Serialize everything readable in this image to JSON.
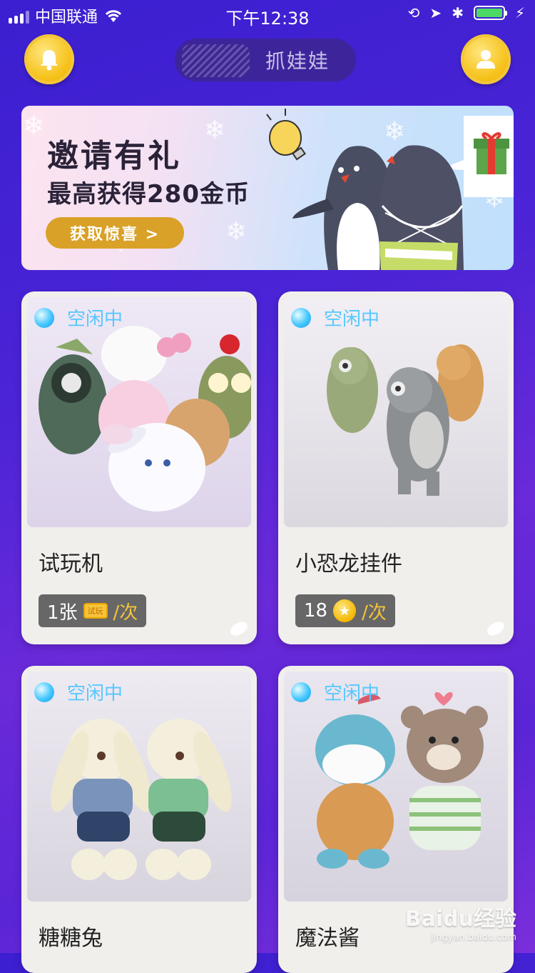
{
  "status_bar": {
    "carrier": "中国联通",
    "time": "下午12:38",
    "battery_color": "#4cd964"
  },
  "header": {
    "title": "抓娃娃",
    "left_icon": "bell-icon",
    "right_icon": "user-icon"
  },
  "banner": {
    "title": "邀请有礼",
    "subtitle": "最高获得280金币",
    "button_label": "获取惊喜 >"
  },
  "machines": [
    {
      "status": "空闲中",
      "name": "试玩机",
      "price_amount": "1张",
      "price_icon": "ticket-icon",
      "ticket_text": "试玩",
      "price_unit": "/次",
      "image": "plush-toy-collection"
    },
    {
      "status": "空闲中",
      "name": "小恐龙挂件",
      "price_amount": "18",
      "price_icon": "coin-icon",
      "price_unit": "/次",
      "image": "plush-dinosaurs"
    },
    {
      "status": "空闲中",
      "name": "糖糖兔",
      "image": "plush-rabbits"
    },
    {
      "status": "空闲中",
      "name": "魔法酱",
      "image": "plush-hippo-and-bear"
    }
  ],
  "watermark": {
    "text": "Baidu经验",
    "url_text": "jingyan.baidu.com"
  },
  "colors": {
    "accent_gold": "#f6c21a",
    "status_blue": "#55c8ff",
    "price_unit": "#f5c43a"
  }
}
